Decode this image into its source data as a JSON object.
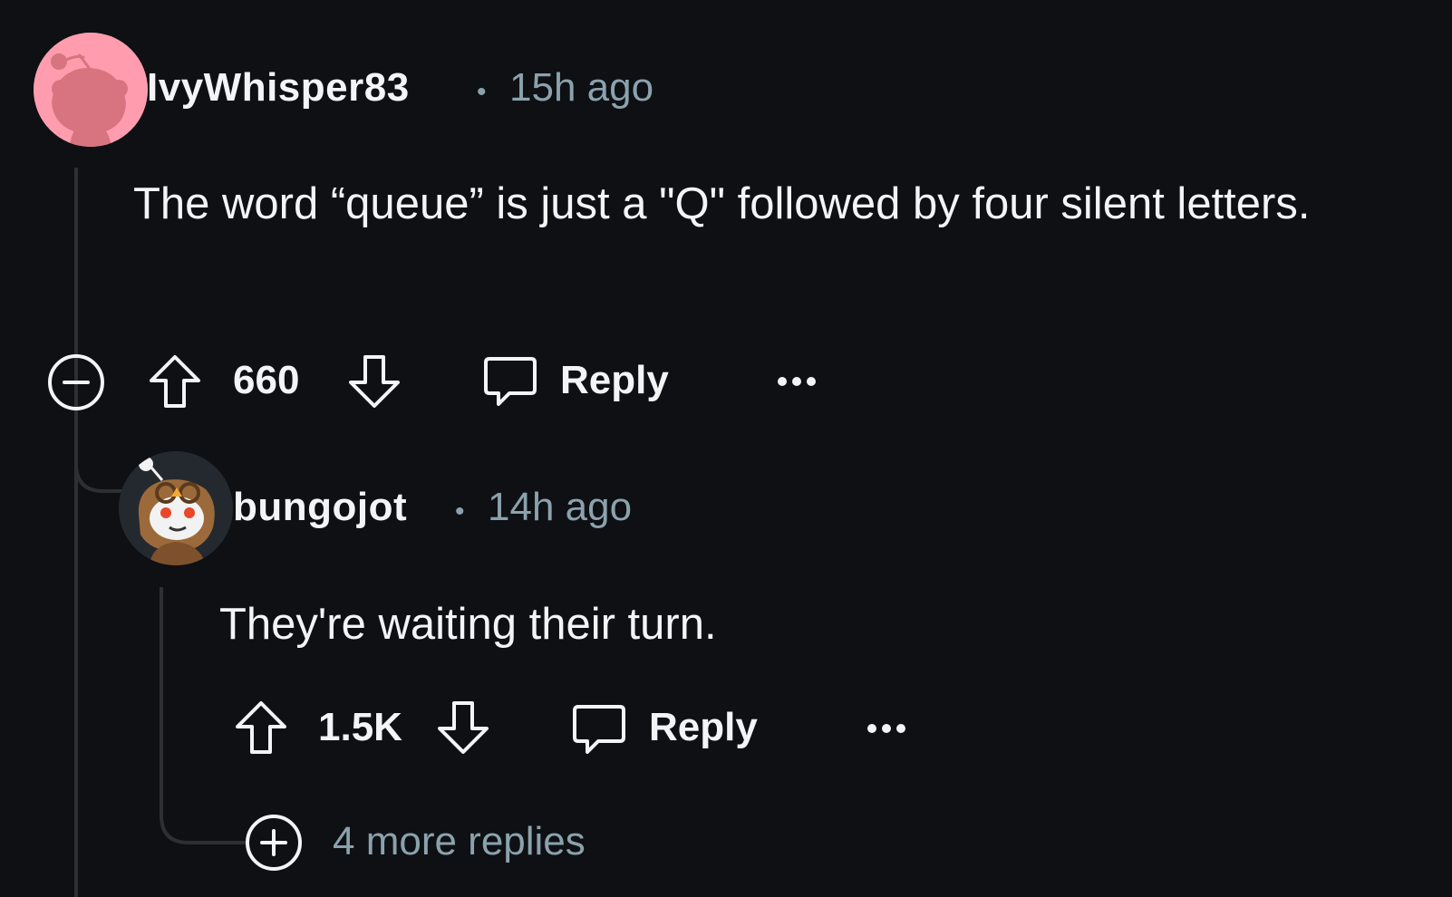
{
  "colors": {
    "background": "#0e1014",
    "text_primary": "#f2f4f5",
    "text_secondary": "#8ba2ad",
    "thread_line": "#2c3035",
    "avatar1_bg": "#ff9dae",
    "avatar2_bg": "#24292f"
  },
  "comments": [
    {
      "username": "IvyWhisper83",
      "separator": "•",
      "time": "15h ago",
      "body": "The word “queue” is just a \"Q\" followed by four silent letters.",
      "votes": "660",
      "reply_label": "Reply",
      "more_icon": "ellipsis-icon",
      "avatar_icon": "snoo-avatar-icon"
    },
    {
      "username": "bungojot",
      "separator": "•",
      "time": "14h ago",
      "body": "They're waiting their turn.",
      "votes": "1.5K",
      "reply_label": "Reply",
      "more_icon": "ellipsis-icon",
      "avatar_icon": "owl-snoo-avatar-icon"
    }
  ],
  "more_replies": {
    "label": "4 more replies",
    "icon": "plus-circle-icon"
  },
  "collapse_icon": "minus-circle-icon"
}
